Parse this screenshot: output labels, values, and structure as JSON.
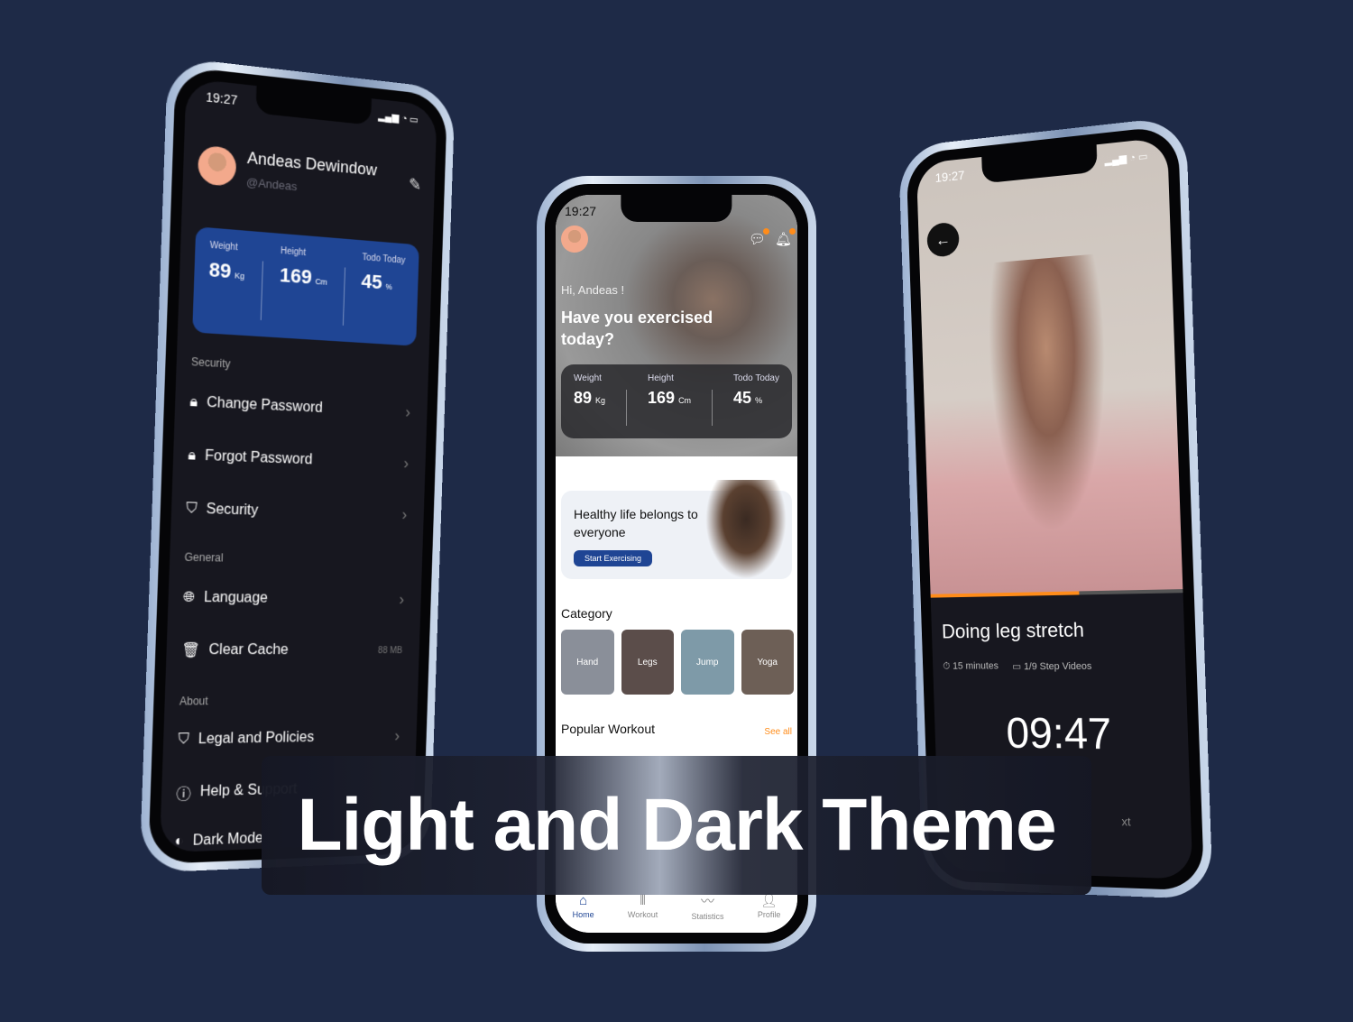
{
  "status_time": "19:27",
  "dark_profile": {
    "name": "Andeas Dewindow",
    "handle": "@Andeas",
    "stats": [
      {
        "label": "Weight",
        "value": "89",
        "unit": "Kg"
      },
      {
        "label": "Height",
        "value": "169",
        "unit": "Cm"
      },
      {
        "label": "Todo Today",
        "value": "45",
        "unit": "%"
      }
    ],
    "sections": {
      "security": "Security",
      "general": "General",
      "about": "About"
    },
    "items": {
      "change_password": "Change Password",
      "forgot_password": "Forgot Password",
      "security": "Security",
      "language": "Language",
      "clear_cache": "Clear Cache",
      "cache_size": "88 MB",
      "legal": "Legal and Policies",
      "help": "Help & Support",
      "dark_mode": "Dark Mode"
    },
    "accent": "#1f4594"
  },
  "home": {
    "greeting": "Hi, Andeas !",
    "question": "Have you exercised today?",
    "stats": [
      {
        "label": "Weight",
        "value": "89",
        "unit": "Kg"
      },
      {
        "label": "Height",
        "value": "169",
        "unit": "Cm"
      },
      {
        "label": "Todo Today",
        "value": "45",
        "unit": "%"
      }
    ],
    "promo": {
      "title": "Healthy life belongs to everyone",
      "button": "Start Exercising"
    },
    "category_title": "Category",
    "categories": [
      "Hand",
      "Legs",
      "Jump",
      "Yoga"
    ],
    "popular_title": "Popular Workout",
    "see_all": "See all",
    "tabs": [
      "Home",
      "Workout",
      "Statistics",
      "Profile"
    ]
  },
  "workout": {
    "title": "Doing leg stretch",
    "duration": "15 minutes",
    "videos": "1/9 Step Videos",
    "timer": "09:47",
    "next_partial": "xt",
    "progress": 0.6
  },
  "banner": {
    "title": "Light and Dark Theme"
  }
}
